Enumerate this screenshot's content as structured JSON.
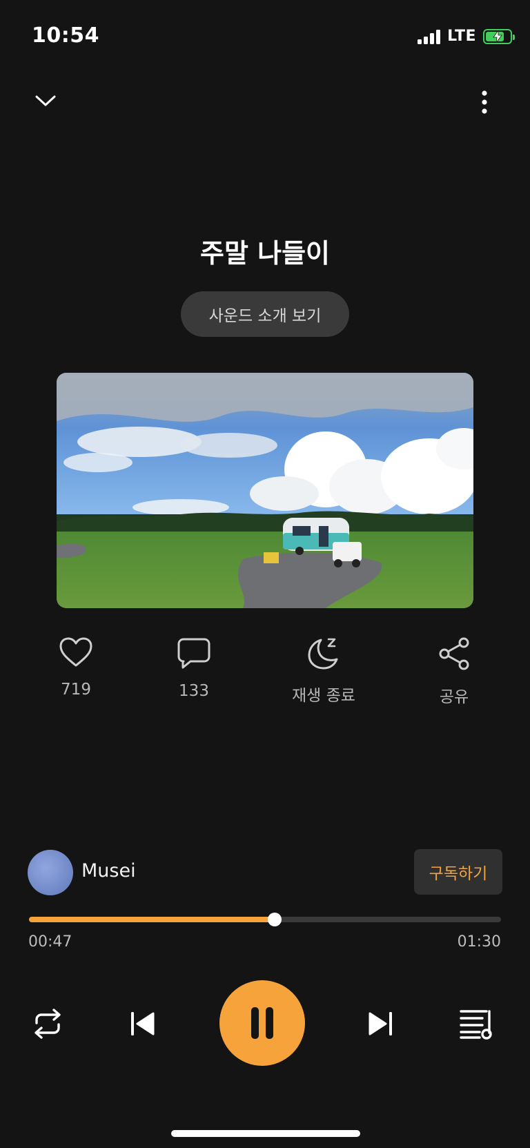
{
  "status_bar": {
    "time": "10:54",
    "network": "LTE"
  },
  "track": {
    "title": "주말 나들이",
    "intro_button": "사운드 소개 보기"
  },
  "actions": {
    "like_count": "719",
    "comment_count": "133",
    "sleep_timer_label": "재생 종료",
    "share_label": "공유"
  },
  "artist": {
    "name": "Musei",
    "subscribe_label": "구독하기"
  },
  "progress": {
    "current": "00:47",
    "total": "01:30",
    "fraction": 0.52
  },
  "colors": {
    "accent": "#f6a33b",
    "background": "#141414",
    "battery": "#3fcf5a"
  },
  "icons": [
    "chevron-down-icon",
    "more-vertical-icon",
    "heart-icon",
    "comment-icon",
    "moon-sleep-icon",
    "share-icon",
    "repeat-icon",
    "skip-previous-icon",
    "pause-icon",
    "skip-next-icon",
    "playlist-icon"
  ]
}
